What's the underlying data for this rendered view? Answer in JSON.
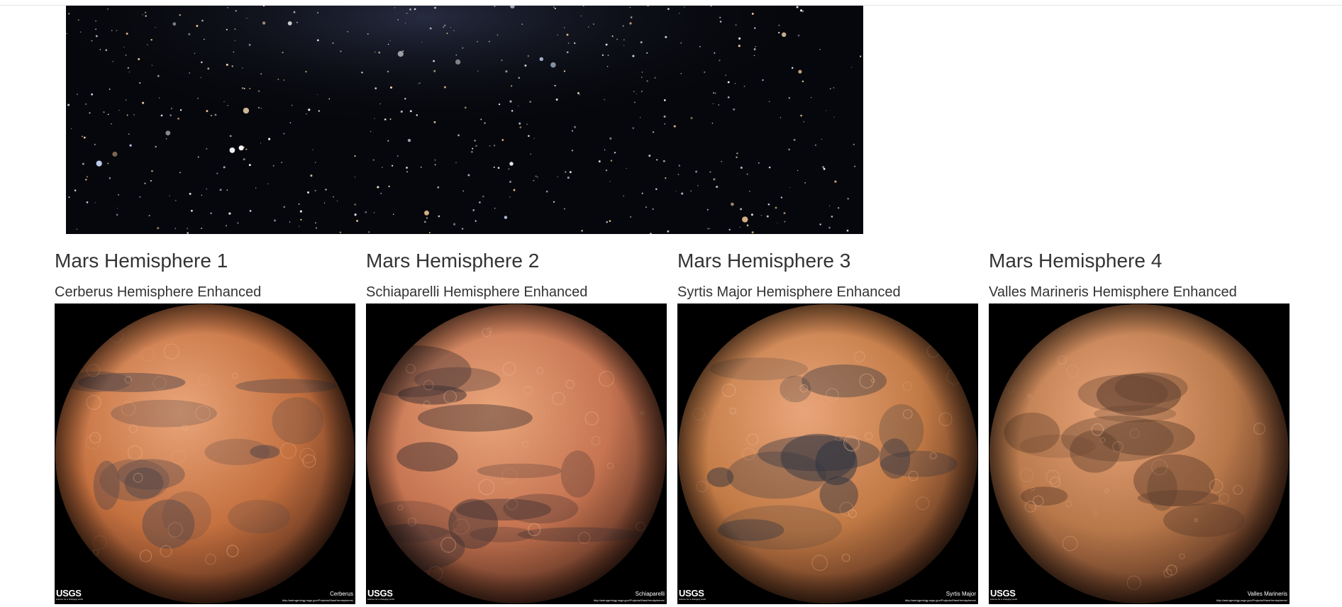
{
  "header_image": {
    "icon": "starfield-image"
  },
  "hemispheres": [
    {
      "heading": "Mars Hemisphere 1",
      "title": "Cerberus Hemisphere Enhanced",
      "image": {
        "icon": "mars-cerberus-image",
        "logo": "USGS",
        "logo_tagline": "science for a changing world",
        "name": "Cerberus",
        "url": "http://astrogeology.usgs.gov/Projects/MarsHemispheres/",
        "base_color": "#c4703f",
        "dark_color": "#4e4448"
      }
    },
    {
      "heading": "Mars Hemisphere 2",
      "title": "Schiaparelli Hemisphere Enhanced",
      "image": {
        "icon": "mars-schiaparelli-image",
        "logo": "USGS",
        "logo_tagline": "science for a changing world",
        "name": "Schiaparelli",
        "url": "http://astrogeology.usgs.gov/Projects/MarsHemispheres/",
        "base_color": "#c67451",
        "dark_color": "#3e3033"
      }
    },
    {
      "heading": "Mars Hemisphere 3",
      "title": "Syrtis Major Hemisphere Enhanced",
      "image": {
        "icon": "mars-syrtis-major-image",
        "logo": "USGS",
        "logo_tagline": "science for a changing world",
        "name": "Syrtis Major",
        "url": "http://astrogeology.usgs.gov/Projects/MarsHemispheres/",
        "base_color": "#c27a45",
        "dark_color": "#2c3340"
      }
    },
    {
      "heading": "Mars Hemisphere 4",
      "title": "Valles Marineris Hemisphere Enhanced",
      "image": {
        "icon": "mars-valles-marineris-image",
        "logo": "USGS",
        "logo_tagline": "science for a changing world",
        "name": "Valles Marineris",
        "url": "http://astrogeology.usgs.gov/Projects/MarsHemispheres/",
        "base_color": "#b8784a",
        "dark_color": "#5a3c2c"
      }
    }
  ]
}
